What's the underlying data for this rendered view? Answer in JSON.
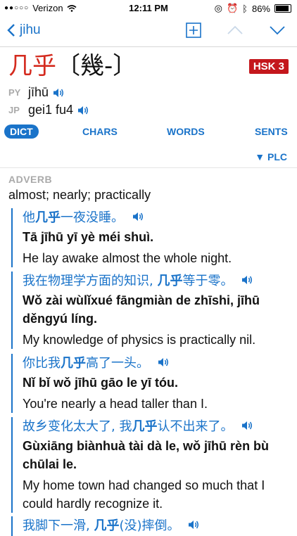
{
  "status": {
    "carrier": "Verizon",
    "time": "12:11 PM",
    "battery": "86%"
  },
  "nav": {
    "back_label": "jihu"
  },
  "entry": {
    "headword": "几乎",
    "traditional": "〔幾-〕",
    "hsk": "HSK 3",
    "py_tag": "PY",
    "pinyin": "jīhū",
    "jp_tag": "JP",
    "jyutping": "gei1 fu4"
  },
  "tabs": [
    "DICT",
    "CHARS",
    "WORDS",
    "SENTS"
  ],
  "plc": "▼ PLC",
  "pos": "ADVERB",
  "gloss": "almost; nearly; practically",
  "examples": [
    {
      "zh_pre": "他",
      "zh_key": "几乎",
      "zh_post": "一夜没睡。",
      "py_pre": "Tā ",
      "py_key": "jīhū",
      "py_post": " yī yè méi shuì.",
      "en": "He lay awake almost the whole night."
    },
    {
      "zh_pre": "我在物理学方面的知识, ",
      "zh_key": "几乎",
      "zh_post": "等于零。",
      "py_pre": "Wǒ zài wùlǐxué fāngmiàn de zhīshi, ",
      "py_key": "jīhū",
      "py_post": " děngyú líng.",
      "en": "My knowledge of physics is practically nil."
    },
    {
      "zh_pre": "你比我",
      "zh_key": "几乎",
      "zh_post": "高了一头。",
      "py_pre": "Nǐ bǐ wǒ ",
      "py_key": "jīhū",
      "py_post": " gāo le yī tóu.",
      "en": "You're nearly a head taller than I."
    },
    {
      "zh_pre": "故乡变化太大了, 我",
      "zh_key": "几乎",
      "zh_post": "认不出来了。",
      "py_pre": "Gùxiāng biànhuà tài dà le, wǒ ",
      "py_key": "jīhū",
      "py_post": " rèn bù chūlai le.",
      "en": "My home town had changed so much that I could hardly recognize it."
    },
    {
      "zh_pre": "我脚下一滑, ",
      "zh_key": "几乎",
      "zh_post": "(没)摔倒。",
      "py_pre": "",
      "py_key": "",
      "py_post": "",
      "en": ""
    }
  ]
}
